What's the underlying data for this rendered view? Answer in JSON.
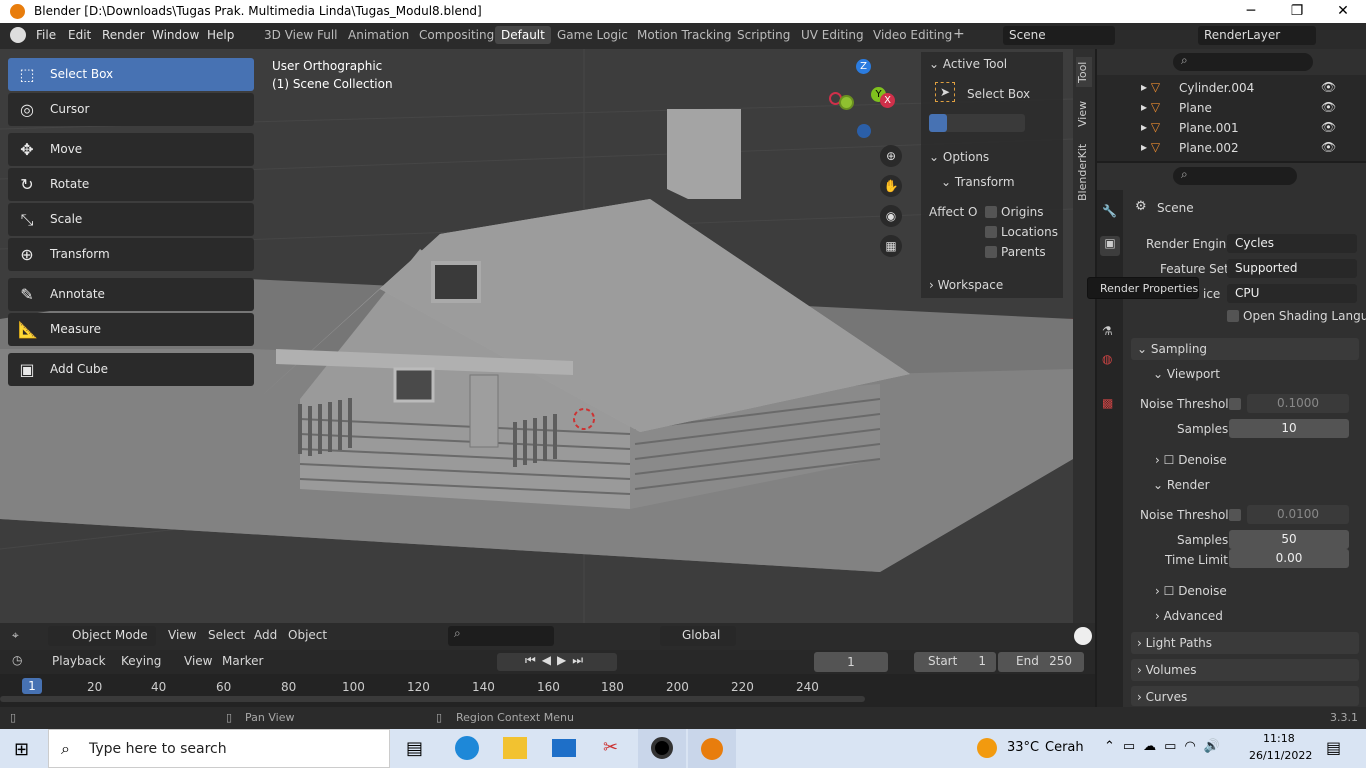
{
  "window": {
    "title": "Blender [D:\\Downloads\\Tugas Prak. Multimedia Linda\\Tugas_Modul8.blend]"
  },
  "menus": [
    "File",
    "Edit",
    "Render",
    "Window",
    "Help"
  ],
  "workspaces": [
    "3D View Full",
    "Animation",
    "Compositing",
    "Default",
    "Game Logic",
    "Motion Tracking",
    "Scripting",
    "UV Editing",
    "Video Editing"
  ],
  "active_workspace": "Default",
  "scene_field": "Scene",
  "renderlayer_field": "RenderLayer",
  "viewport": {
    "view_name": "User Orthographic",
    "collection": "(1) Scene Collection",
    "tools": [
      "Select Box",
      "Cursor",
      "Move",
      "Rotate",
      "Scale",
      "Transform",
      "Annotate",
      "Measure",
      "Add Cube"
    ],
    "gizmo": {
      "z": "Z",
      "y": "Y",
      "x": "X"
    }
  },
  "npanel": {
    "active_tool": "Active Tool",
    "tool_name": "Select Box",
    "options": "Options",
    "transform": "Transform",
    "affect_label": "Affect O",
    "origins": "Origins",
    "locations": "Locations",
    "parents": "Parents",
    "workspace": "Workspace",
    "tabs": [
      "Tool",
      "View",
      "BlenderKit"
    ]
  },
  "outliner": {
    "rows": [
      "Cylinder.004",
      "Plane",
      "Plane.001",
      "Plane.002"
    ]
  },
  "properties": {
    "context": "Scene",
    "render_engine_label": "Render Engine",
    "render_engine": "Cycles",
    "feature_set_label": "Feature Set",
    "feature_set": "Supported",
    "device_label": "ice",
    "device": "CPU",
    "osl": "Open Shading Langu...",
    "sampling": "Sampling",
    "viewport": "Viewport",
    "noise_threshold_label": "Noise Threshold",
    "viewport_noise": "0.1000",
    "samples_label": "Samples",
    "viewport_samples": "10",
    "denoise": "Denoise",
    "render": "Render",
    "render_noise": "0.0100",
    "render_samples": "50",
    "time_limit_label": "Time Limit",
    "time_limit": "0.00",
    "advanced": "Advanced",
    "light_paths": "Light Paths",
    "volumes": "Volumes",
    "curves": "Curves",
    "tooltip": "Render Properties"
  },
  "view_header": {
    "mode": "Object Mode",
    "menus": [
      "View",
      "Select",
      "Add",
      "Object"
    ],
    "orientation": "Global"
  },
  "timeline": {
    "menus": [
      "Playback",
      "Keying",
      "View",
      "Marker"
    ],
    "current_frame": "1",
    "start_label": "Start",
    "start": "1",
    "end_label": "End",
    "end": "250",
    "ruler": [
      "1",
      "20",
      "40",
      "60",
      "80",
      "100",
      "120",
      "140",
      "160",
      "180",
      "200",
      "220",
      "240"
    ]
  },
  "status": {
    "pan": "Pan View",
    "context": "Region Context Menu",
    "version": "3.3.1"
  },
  "taskbar": {
    "search_placeholder": "Type here to search",
    "weather_temp": "33°C",
    "weather_text": "Cerah",
    "time": "11:18",
    "date": "26/11/2022"
  }
}
